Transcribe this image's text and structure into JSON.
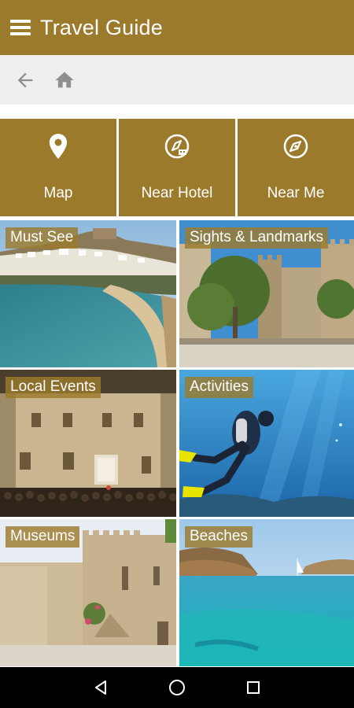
{
  "app_bar": {
    "title": "Travel Guide",
    "menu_icon": "menu-icon"
  },
  "nav_bar": {
    "back_icon": "arrow-back-icon",
    "home_icon": "home-icon"
  },
  "quick_actions": [
    {
      "label": "Map",
      "icon": "map-pin-icon"
    },
    {
      "label": "Near Hotel",
      "icon": "hotel-compass-icon"
    },
    {
      "label": "Near Me",
      "icon": "compass-icon"
    }
  ],
  "categories": [
    {
      "label": "Must See"
    },
    {
      "label": "Sights & Landmarks"
    },
    {
      "label": "Local Events"
    },
    {
      "label": "Activities"
    },
    {
      "label": "Museums"
    },
    {
      "label": "Beaches"
    }
  ],
  "system_nav": {
    "back": "triangle-back-icon",
    "home": "circle-home-icon",
    "recents": "square-recents-icon"
  },
  "colors": {
    "accent": "#9c7a2c",
    "nav_bg": "#efefef",
    "system_bar": "#000000"
  }
}
